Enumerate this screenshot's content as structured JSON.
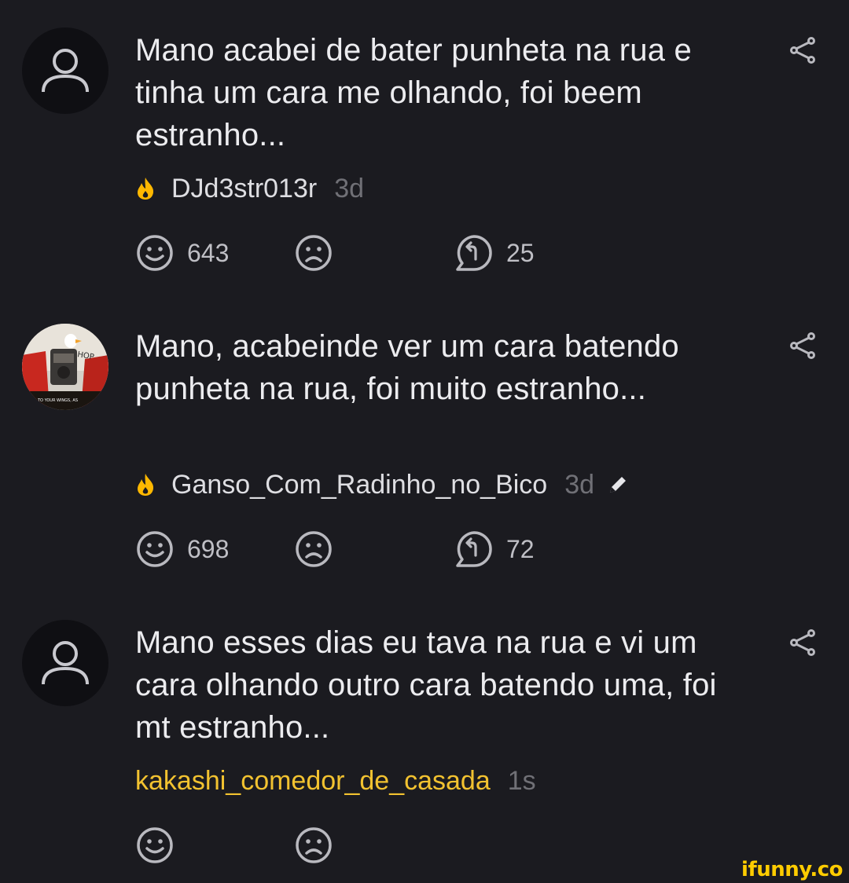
{
  "comments": [
    {
      "text": "Mano acabei de bater punheta na rua e tinha um cara me olhando, foi beem estranho...",
      "username": "DJd3str013r",
      "time": "3d",
      "smiles": "643",
      "replies": "25",
      "avatar": "default-user-icon",
      "badge": "fire-icon"
    },
    {
      "text": "Mano, acabeinde ver um cara batendo punheta na rua, foi muito estranho...",
      "username": "Ganso_Com_Radinho_no_Bico",
      "time": "3d",
      "smiles": "698",
      "replies": "72",
      "avatar": "goose-radio-picture",
      "badge": "fire-icon",
      "edited": "pencil-icon"
    },
    {
      "text": "Mano esses dias eu tava na rua e vi um cara olhando outro cara batendo uma, foi mt estranho...",
      "username": "kakashi_comedor_de_casada",
      "time": "1s",
      "avatar": "default-user-icon",
      "username_color": "#f2c230"
    }
  ],
  "watermark": "ifunny.co",
  "colors": {
    "background": "#1b1b20",
    "fire": "#ffb800",
    "time": "#707076",
    "icons": "#b9b9bf"
  }
}
